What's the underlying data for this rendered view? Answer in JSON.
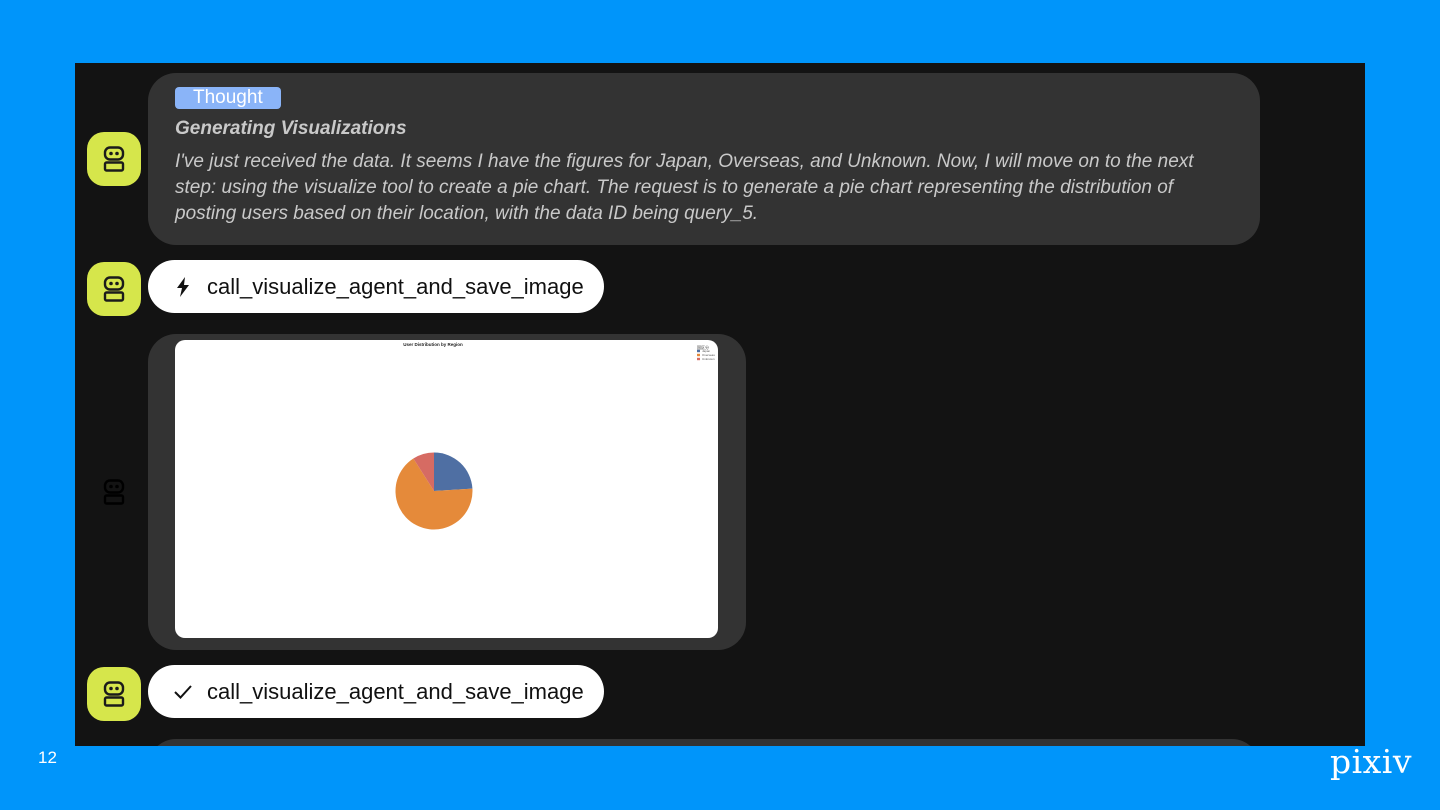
{
  "slide": {
    "number": "12",
    "logo": "pixiv"
  },
  "colors": {
    "background": "#0095fa",
    "avatar": "#d6e64b",
    "badge": "#8ab4f8",
    "card": "#333333"
  },
  "thought": {
    "badge": "Thought",
    "title": "Generating Visualizations",
    "body": "I've just received the data. It seems I have the figures for Japan, Overseas, and Unknown. Now, I will move on to the next step: using the visualize tool to create a pie chart. The request is to generate a pie chart representing the distribution of posting users based on their location, with the data ID being query_5."
  },
  "tool_calls": [
    {
      "icon": "lightning-icon",
      "label": "call_visualize_agent_and_save_image"
    },
    {
      "icon": "check-icon",
      "label": "call_visualize_agent_and_save_image"
    }
  ],
  "chart_data": {
    "type": "pie",
    "title": "User Distribution by Region",
    "legend_title": "国区分",
    "legend_position": "top-right",
    "categories": [
      "Japan",
      "Overseas",
      "Unknown"
    ],
    "values": [
      24,
      67,
      9
    ],
    "colors": [
      "#4f6fa3",
      "#e58a3a",
      "#d66b63"
    ]
  }
}
